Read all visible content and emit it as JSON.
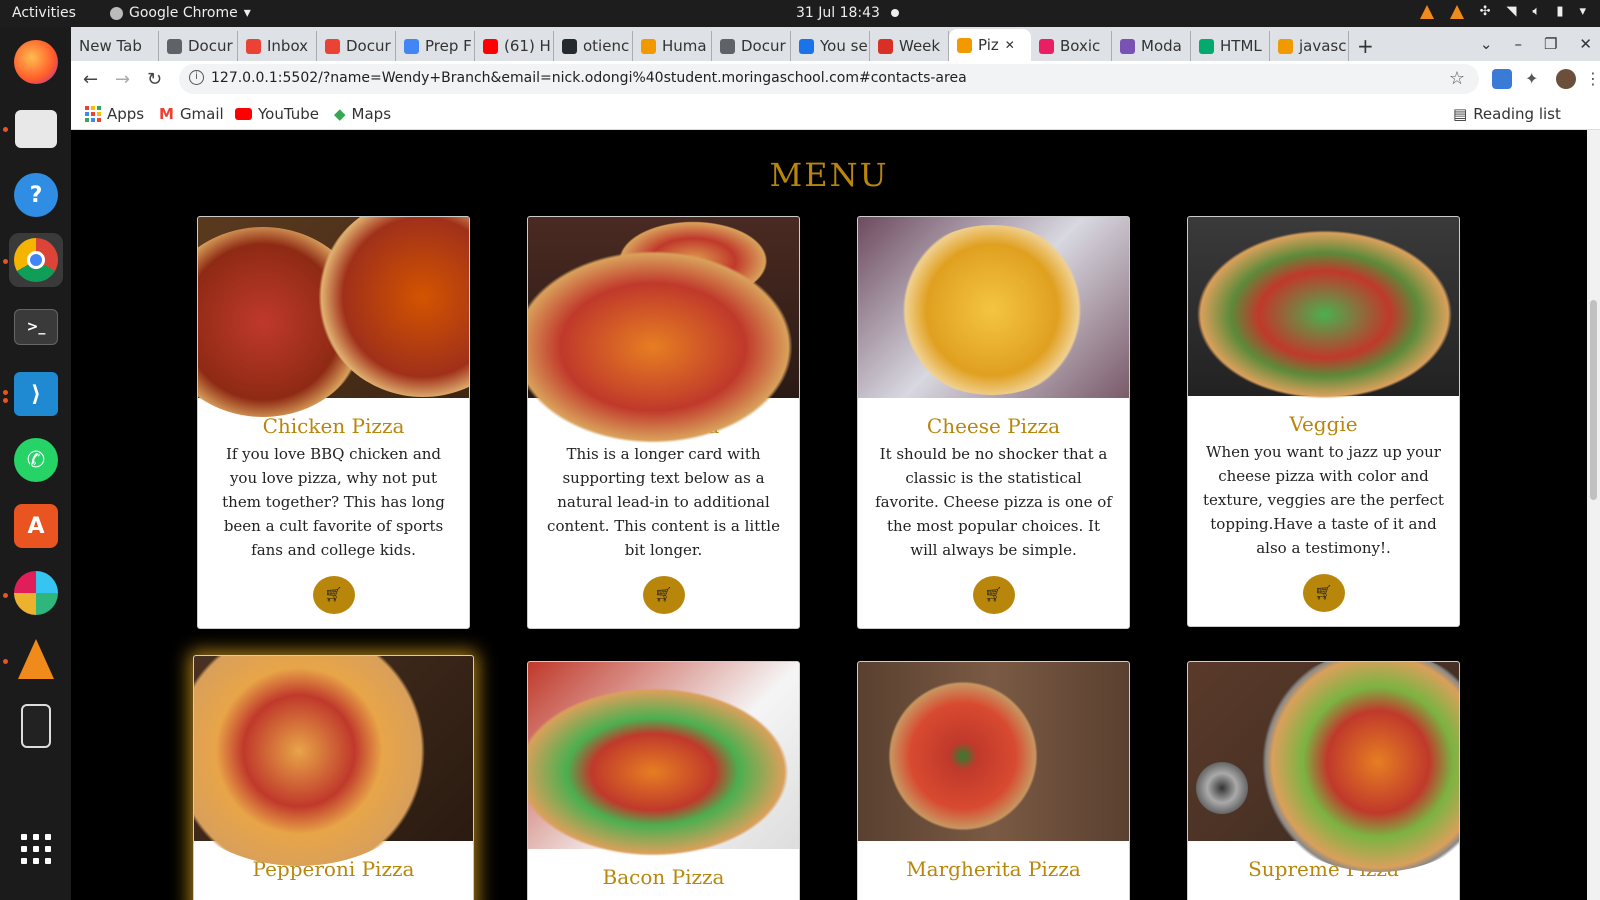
{
  "system": {
    "activities": "Activities",
    "app_name": "Google Chrome",
    "clock": "31 Jul  18:43"
  },
  "browser": {
    "tabs": [
      {
        "label": "New Tab",
        "color": "#dee1e6"
      },
      {
        "label": "Docur",
        "color": "#5f6368"
      },
      {
        "label": "Inbox",
        "color": "#ea4335"
      },
      {
        "label": "Docur",
        "color": "#ea4335"
      },
      {
        "label": "Prep F",
        "color": "#4285f4"
      },
      {
        "label": "(61) H",
        "color": "#ff0000"
      },
      {
        "label": "otienc",
        "color": "#24292e"
      },
      {
        "label": "Huma",
        "color": "#f29900"
      },
      {
        "label": "Docur",
        "color": "#5f6368"
      },
      {
        "label": "You se",
        "color": "#1a73e8"
      },
      {
        "label": "Week",
        "color": "#d93025"
      },
      {
        "label": "Piz",
        "color": "#f29900",
        "active": true
      },
      {
        "label": "Boxic",
        "color": "#e91e63"
      },
      {
        "label": "Moda",
        "color": "#7952b3"
      },
      {
        "label": "HTML",
        "color": "#04aa6d"
      },
      {
        "label": "javasc",
        "color": "#f29900"
      }
    ],
    "url": "127.0.0.1:5502/?name=Wendy+Branch&email=nick.odongi%40student.moringaschool.com#contacts-area",
    "bookmarks": [
      {
        "label": "Apps",
        "icon": "apps-grid-icon"
      },
      {
        "label": "Gmail",
        "icon": "gmail-icon"
      },
      {
        "label": "YouTube",
        "icon": "youtube-icon"
      },
      {
        "label": "Maps",
        "icon": "maps-icon"
      }
    ],
    "reading_list": "Reading list"
  },
  "page": {
    "title": "MENU",
    "accent": "#b8860b",
    "cards": [
      {
        "name": "Chicken Pizza",
        "desc": "If you love BBQ chicken and you love pizza, why not put them together? This has long been a cult favorite of sports fans and college kids."
      },
      {
        "name": "Meat Pizza",
        "desc": "This is a longer card with supporting text below as a natural lead-in to additional content. This content is a little bit longer."
      },
      {
        "name": "Cheese Pizza",
        "desc": "It should be no shocker that a classic is the statistical favorite. Cheese pizza is one of the most popular choices. It will always be simple."
      },
      {
        "name": "Veggie",
        "desc": "When you want to jazz up your cheese pizza with color and texture, veggies are the perfect topping.Have a taste of it and also a testimony!."
      },
      {
        "name": "Pepperoni Pizza"
      },
      {
        "name": "Bacon Pizza"
      },
      {
        "name": "Margherita Pizza"
      },
      {
        "name": "Supreme Pizza"
      }
    ]
  }
}
